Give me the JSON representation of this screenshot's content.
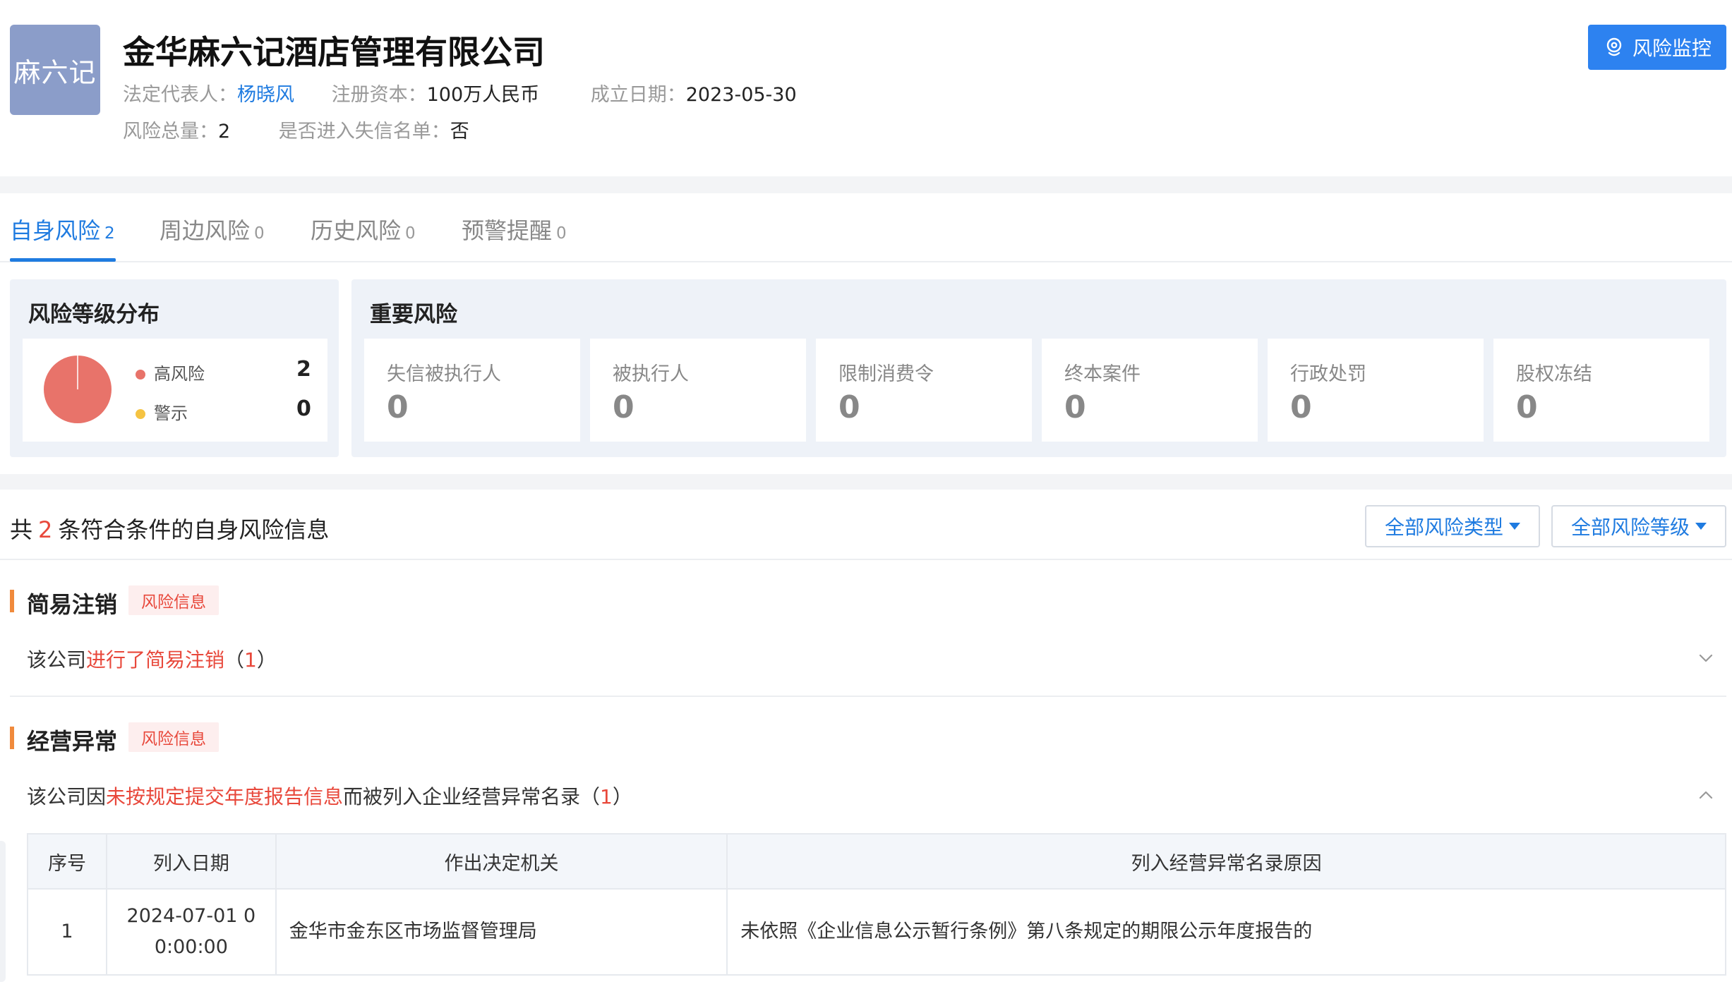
{
  "header": {
    "logo_text": "麻六记",
    "company_name": "金华麻六记酒店管理有限公司",
    "legal_rep_label": "法定代表人：",
    "legal_rep_value": "杨晓风",
    "reg_capital_label": "注册资本：",
    "reg_capital_value": "100万人民币",
    "founded_label": "成立日期：",
    "founded_value": "2023-05-30",
    "risk_total_label": "风险总量：",
    "risk_total_value": "2",
    "dishonest_label": "是否进入失信名单：",
    "dishonest_value": "否",
    "monitor_button": "风险监控"
  },
  "tabs": [
    {
      "label": "自身风险",
      "count": "2",
      "active": true
    },
    {
      "label": "周边风险",
      "count": "0",
      "active": false
    },
    {
      "label": "历史风险",
      "count": "0",
      "active": false
    },
    {
      "label": "预警提醒",
      "count": "0",
      "active": false
    }
  ],
  "distribution": {
    "title": "风险等级分布",
    "items": [
      {
        "label": "高风险",
        "value": "2",
        "color": "#e8736a"
      },
      {
        "label": "警示",
        "value": "0",
        "color": "#f5c342"
      }
    ]
  },
  "important": {
    "title": "重要风险",
    "cards": [
      {
        "label": "失信被执行人",
        "value": "0"
      },
      {
        "label": "被执行人",
        "value": "0"
      },
      {
        "label": "限制消费令",
        "value": "0"
      },
      {
        "label": "终本案件",
        "value": "0"
      },
      {
        "label": "行政处罚",
        "value": "0"
      },
      {
        "label": "股权冻结",
        "value": "0"
      }
    ]
  },
  "list": {
    "prefix": "共",
    "count": "2",
    "suffix": "条符合条件的自身风险信息",
    "filter_type": "全部风险类型",
    "filter_level": "全部风险等级"
  },
  "sections": [
    {
      "title": "简易注销",
      "tag": "风险信息",
      "desc_prefix": "该公司",
      "desc_highlight": "进行了简易注销",
      "desc_suffix_open": "（",
      "desc_count": "1",
      "desc_suffix_close": "）",
      "expanded": false
    },
    {
      "title": "经营异常",
      "tag": "风险信息",
      "desc_prefix": "该公司因",
      "desc_highlight": "未按规定提交年度报告信息",
      "desc_suffix_open": "而被列入企业经营异常名录（",
      "desc_count": "1",
      "desc_suffix_close": "）",
      "expanded": true
    }
  ],
  "table": {
    "headers": [
      "序号",
      "列入日期",
      "作出决定机关",
      "列入经营异常名录原因"
    ],
    "rows": [
      {
        "index": "1",
        "date_line1": "2024-07-01 0",
        "date_line2": "0:00:00",
        "authority": "金华市金东区市场监督管理局",
        "reason": "未依照《企业信息公示暂行条例》第八条规定的期限公示年度报告的"
      }
    ]
  },
  "colors": {
    "accent": "#1f7be0",
    "danger": "#e8483b",
    "section_bar": "#f08a3c",
    "panel_bg": "#eef2f8"
  }
}
